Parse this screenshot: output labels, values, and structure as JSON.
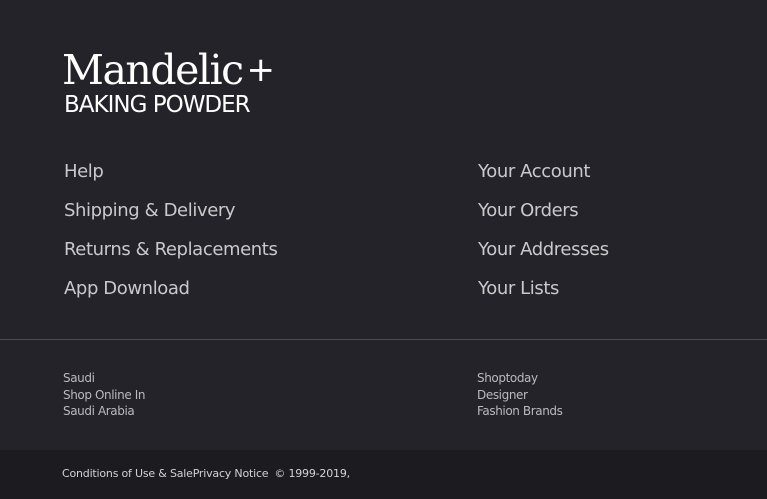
{
  "logo": {
    "brand": "Mandelic",
    "plus": "+",
    "subtitle": "BAKING POWDER"
  },
  "links_left": [
    {
      "label": "Help"
    },
    {
      "label": "Shipping & Delivery"
    },
    {
      "label": "Returns & Replacements"
    },
    {
      "label": "App Download"
    }
  ],
  "links_right": [
    {
      "label": "Your Account"
    },
    {
      "label": "Your Orders"
    },
    {
      "label": "Your Addresses"
    },
    {
      "label": "Your Lists"
    }
  ],
  "info_left": [
    "Saudi",
    "Shop Online In",
    "Saudi Arabia"
  ],
  "info_right": [
    "Shoptoday",
    "Designer",
    "Fashion Brands"
  ],
  "legal": {
    "conditions": "Conditions of Use & Sale",
    "privacy": "Privacy Notice",
    "copyright": "© 1999-2019,"
  }
}
